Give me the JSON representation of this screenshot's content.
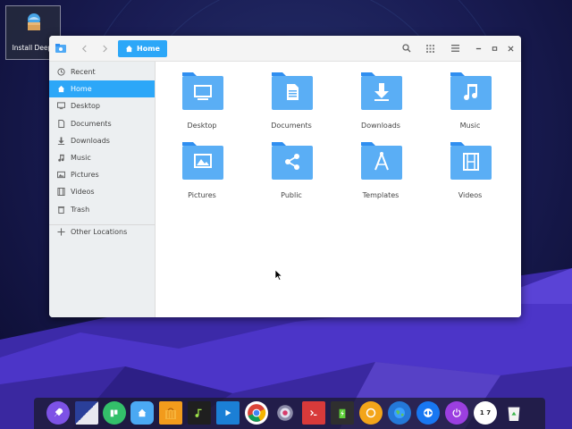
{
  "desktop": {
    "icon_label": "Install Deepi"
  },
  "window": {
    "breadcrumb": "Home"
  },
  "sidebar": {
    "items": [
      {
        "label": "Recent",
        "icon": "clock-icon"
      },
      {
        "label": "Home",
        "icon": "home-icon"
      },
      {
        "label": "Desktop",
        "icon": "desktop-icon"
      },
      {
        "label": "Documents",
        "icon": "document-icon"
      },
      {
        "label": "Downloads",
        "icon": "download-icon"
      },
      {
        "label": "Music",
        "icon": "music-icon"
      },
      {
        "label": "Pictures",
        "icon": "picture-icon"
      },
      {
        "label": "Videos",
        "icon": "video-icon"
      },
      {
        "label": "Trash",
        "icon": "trash-icon"
      }
    ],
    "other_locations": "Other Locations"
  },
  "folders": [
    {
      "label": "Desktop",
      "icon": "monitor-icon"
    },
    {
      "label": "Documents",
      "icon": "document-icon"
    },
    {
      "label": "Downloads",
      "icon": "download-arrow-icon"
    },
    {
      "label": "Music",
      "icon": "music-note-icon"
    },
    {
      "label": "Pictures",
      "icon": "picture-icon"
    },
    {
      "label": "Public",
      "icon": "share-icon"
    },
    {
      "label": "Templates",
      "icon": "compass-icon"
    },
    {
      "label": "Videos",
      "icon": "film-icon"
    }
  ],
  "dock": {
    "clock_text": "1 7"
  },
  "colors": {
    "accent": "#2ca7f8",
    "folder": "#5aaef5",
    "folder_tab": "#2f8ef0",
    "desktop_top": "#0f1340",
    "desktop_bottom": "#4a2fc4"
  }
}
